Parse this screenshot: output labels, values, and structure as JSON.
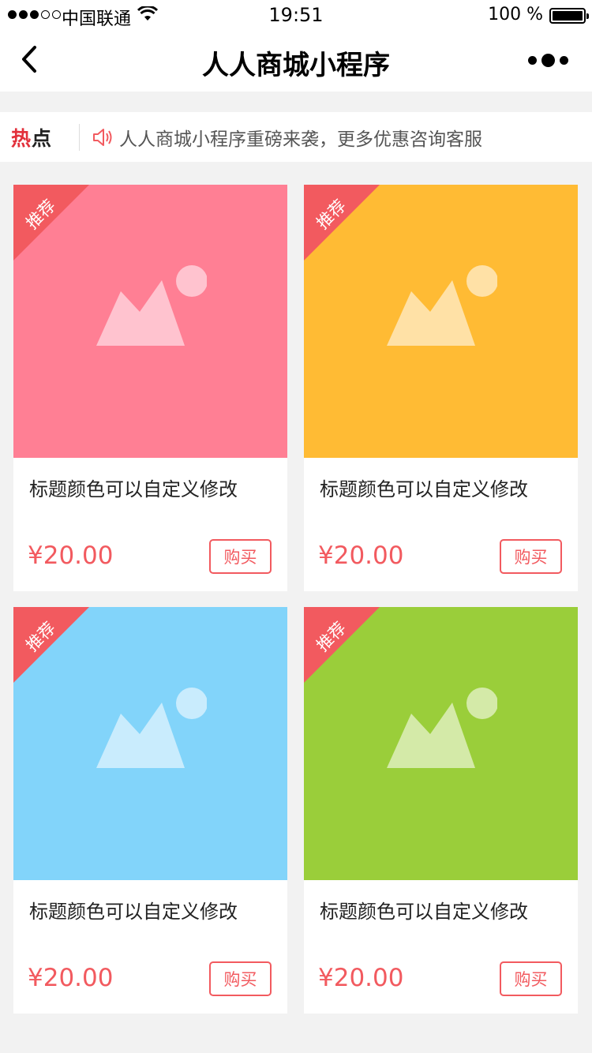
{
  "status_bar": {
    "carrier": "中国联通",
    "time": "19:51",
    "battery": "100 %"
  },
  "nav": {
    "title": "人人商城小程序"
  },
  "notice": {
    "label_red": "热",
    "label_black": "点",
    "text": "人人商城小程序重磅来袭，更多优惠咨询客服"
  },
  "products": [
    {
      "badge": "推荐",
      "title": "标题颜色可以自定义修改",
      "price": "¥20.00",
      "buy_label": "购买",
      "bg_color": "#ff7f94",
      "icon_color": "#ffc3cf"
    },
    {
      "badge": "推荐",
      "title": "标题颜色可以自定义修改",
      "price": "¥20.00",
      "buy_label": "购买",
      "bg_color": "#ffbb34",
      "icon_color": "#ffe1a6"
    },
    {
      "badge": "推荐",
      "title": "标题颜色可以自定义修改",
      "price": "¥20.00",
      "buy_label": "购买",
      "bg_color": "#82d4fa",
      "icon_color": "#c9ecfd"
    },
    {
      "badge": "推荐",
      "title": "标题颜色可以自定义修改",
      "price": "¥20.00",
      "buy_label": "购买",
      "bg_color": "#9ace3a",
      "icon_color": "#d4eaa8"
    }
  ],
  "colors": {
    "accent": "#f25a5f",
    "page_bg": "#f2f2f2"
  }
}
